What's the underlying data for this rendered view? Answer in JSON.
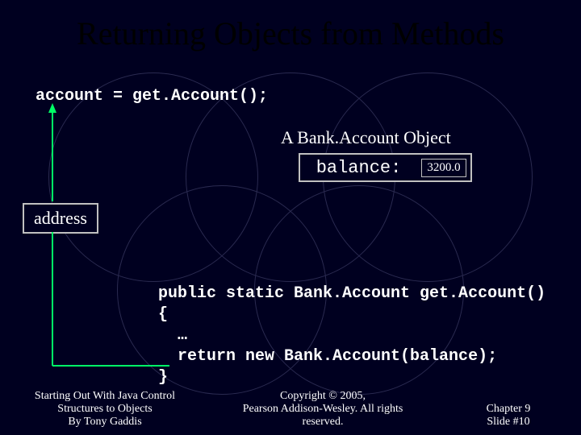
{
  "title": "Returning Objects from Methods",
  "code_line": "account = get.Account();",
  "object_label": "A Bank.Account Object",
  "balance_field": "balance:",
  "balance_value": "3200.0",
  "address_label": "address",
  "method": {
    "sig": "public static Bank.Account get.Account()",
    "open": "{",
    "ellipsis": "  …",
    "ret": "  return new Bank.Account(balance);",
    "close": "}"
  },
  "footer": {
    "left1": "Starting Out With Java Control",
    "left2": "Structures to Objects",
    "left3": "By Tony Gaddis",
    "center1": "Copyright © 2005,",
    "center2": "Pearson Addison-Wesley. All rights",
    "center3": "reserved.",
    "right1": "Chapter 9",
    "right2": "Slide #10"
  }
}
